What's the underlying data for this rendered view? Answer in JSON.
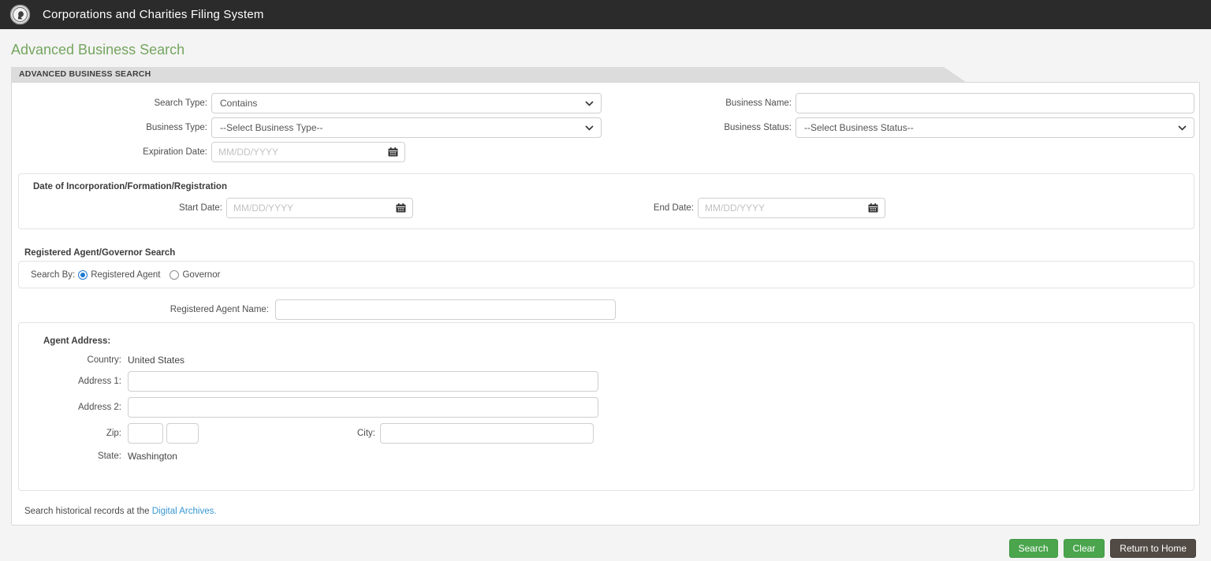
{
  "colors": {
    "header_bg": "#2b2b2b",
    "page_title_green": "#75a55f",
    "tab_bg": "#dcdcdc",
    "button_green": "#4aa54d",
    "button_dark": "#524b45",
    "link_blue": "#3797d3",
    "radio_selected_blue": "#1f7ad1"
  },
  "header": {
    "logo": "washington-state-seal",
    "title": "Corporations and Charities Filing System"
  },
  "page": {
    "title": "Advanced Business Search",
    "panel_heading": "ADVANCED BUSINESS SEARCH"
  },
  "form": {
    "search_type": {
      "label": "Search Type:",
      "value": "Contains"
    },
    "business_name": {
      "label": "Business Name:",
      "value": ""
    },
    "business_type": {
      "label": "Business Type:",
      "value": "--Select Business Type--"
    },
    "business_status": {
      "label": "Business Status:",
      "value": "--Select Business Status--"
    },
    "expiration_date": {
      "label": "Expiration Date:",
      "value": "",
      "placeholder": "MM/DD/YYYY"
    },
    "incorporation": {
      "heading": "Date of Incorporation/Formation/Registration",
      "start_date": {
        "label": "Start Date:",
        "value": "",
        "placeholder": "MM/DD/YYYY"
      },
      "end_date": {
        "label": "End Date:",
        "value": "",
        "placeholder": "MM/DD/YYYY"
      }
    },
    "agent_search": {
      "heading": "Registered Agent/Governor Search",
      "search_by_label": "Search By:",
      "options": [
        {
          "label": "Registered Agent",
          "selected": true
        },
        {
          "label": "Governor",
          "selected": false
        }
      ],
      "agent_name": {
        "label": "Registered Agent Name:",
        "value": ""
      }
    },
    "agent_address": {
      "heading": "Agent Address:",
      "country": {
        "label": "Country:",
        "value": "United States"
      },
      "address1": {
        "label": "Address 1:",
        "value": ""
      },
      "address2": {
        "label": "Address 2:",
        "value": ""
      },
      "zip": {
        "label": "Zip:",
        "value_5": "",
        "value_4": ""
      },
      "city": {
        "label": "City:",
        "value": ""
      },
      "state": {
        "label": "State:",
        "value": "Washington"
      }
    },
    "historical_note": {
      "text": "Search historical records at the",
      "link_label": "Digital Archives."
    }
  },
  "footer": {
    "search_label": "Search",
    "clear_label": "Clear",
    "return_home_label": "Return to Home"
  }
}
